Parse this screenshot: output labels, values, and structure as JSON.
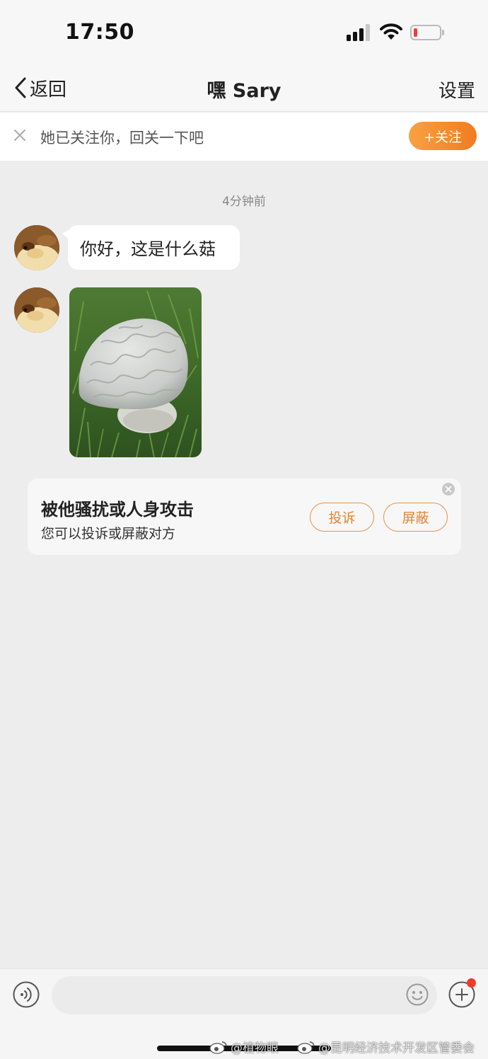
{
  "status_bar": {
    "time": "17:50",
    "battery_color": "#f23a3a"
  },
  "nav": {
    "back_label": "返回",
    "title": "嘿 Sary",
    "settings_label": "设置"
  },
  "follow_banner": {
    "text": "她已关注你，回关一下吧",
    "follow_button_label": "+关注",
    "accent_color": "#f28a2e"
  },
  "chat": {
    "timestamp": "4分钟前",
    "messages": [
      {
        "type": "text",
        "text": "你好，这是什么菇"
      },
      {
        "type": "image",
        "icon": "mushroom-photo"
      }
    ]
  },
  "report_card": {
    "title": "被他骚扰或人身攻击",
    "subtitle": "您可以投诉或屏蔽对方",
    "report_button": "投诉",
    "block_button": "屏蔽"
  },
  "input_bar": {
    "placeholder": "",
    "icons": [
      "voice-icon",
      "emoji-icon",
      "plus-icon"
    ]
  },
  "watermarks": [
    "@植物眼",
    "@昆明经济技术开发区管委会"
  ]
}
